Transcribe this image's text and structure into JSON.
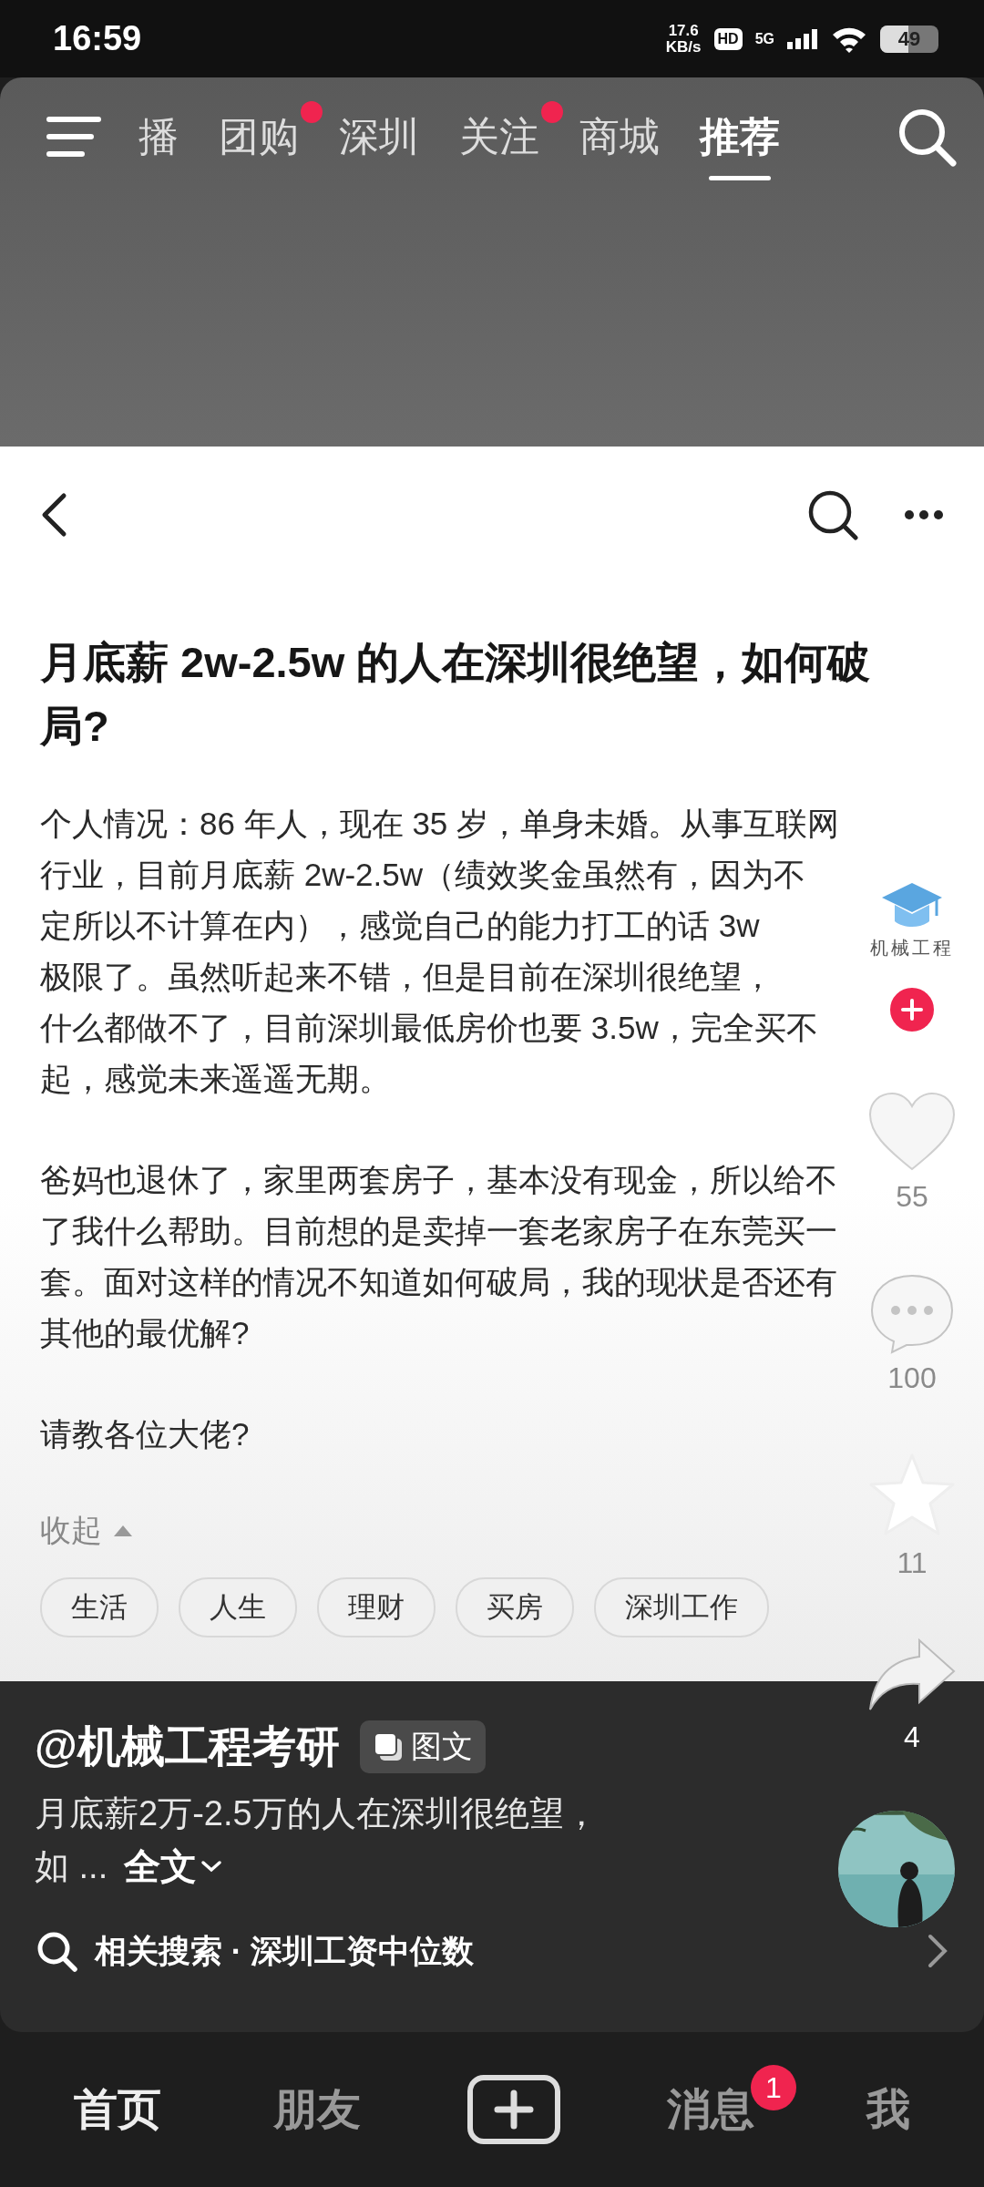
{
  "status_bar": {
    "time": "16:59",
    "speed": "17.6",
    "speed_unit": "KB/s",
    "hd": "HD",
    "network": "5G",
    "battery": "49"
  },
  "top_tabs": [
    {
      "label": "播",
      "selected": false,
      "dot": false
    },
    {
      "label": "团购",
      "selected": false,
      "dot": true
    },
    {
      "label": "深圳",
      "selected": false,
      "dot": false
    },
    {
      "label": "关注",
      "selected": false,
      "dot": true
    },
    {
      "label": "商城",
      "selected": false,
      "dot": false
    },
    {
      "label": "推荐",
      "selected": true,
      "dot": false
    }
  ],
  "post": {
    "title": "月底薪 2w-2.5w 的人在深圳很绝望，如何破局?",
    "paragraphs": [
      [
        "个人情况：86 年人，现在 35 岁，单身未婚。从事互联网",
        "行业，目前月底薪 2w-2.5w（绩效奖金虽然有，因为不",
        "定所以不计算在内），感觉自己的能力打工的话 3w",
        "极限了。虽然听起来不错，但是目前在深圳很绝望，",
        "什么都做不了，目前深圳最低房价也要 3.5w，完全买不",
        "起，感觉未来遥遥无期。"
      ],
      [
        "爸妈也退休了，家里两套房子，基本没有现金，所以给不",
        "了我什么帮助。目前想的是卖掉一套老家房子在东莞买一",
        "套。面对这样的情况不知道如何破局，我的现状是否还有",
        "其他的最优解?"
      ],
      [
        "请教各位大佬?"
      ]
    ],
    "collapse": "收起",
    "tags": [
      "生活",
      "人生",
      "理财",
      "买房",
      "深圳工作"
    ]
  },
  "side_actions": {
    "avatar_label": "机械工程",
    "items": [
      {
        "kind": "like",
        "count": "55"
      },
      {
        "kind": "comment",
        "count": "100"
      },
      {
        "kind": "favorite",
        "count": "11"
      },
      {
        "kind": "share",
        "count": "4"
      }
    ]
  },
  "caption": {
    "author": "@机械工程考研",
    "badge": "图文",
    "lines": [
      "月底薪2万-2.5万的人在深圳很绝望，",
      "如 ..."
    ],
    "more": "全文",
    "related_search": "相关搜索 · 深圳工资中位数"
  },
  "bottom_nav": [
    {
      "kind": "tab",
      "label": "首页",
      "selected": true
    },
    {
      "kind": "tab",
      "label": "朋友",
      "selected": false
    },
    {
      "kind": "add"
    },
    {
      "kind": "tab",
      "label": "消息",
      "selected": false,
      "badge": "1"
    },
    {
      "kind": "tab",
      "label": "我",
      "selected": false
    }
  ]
}
